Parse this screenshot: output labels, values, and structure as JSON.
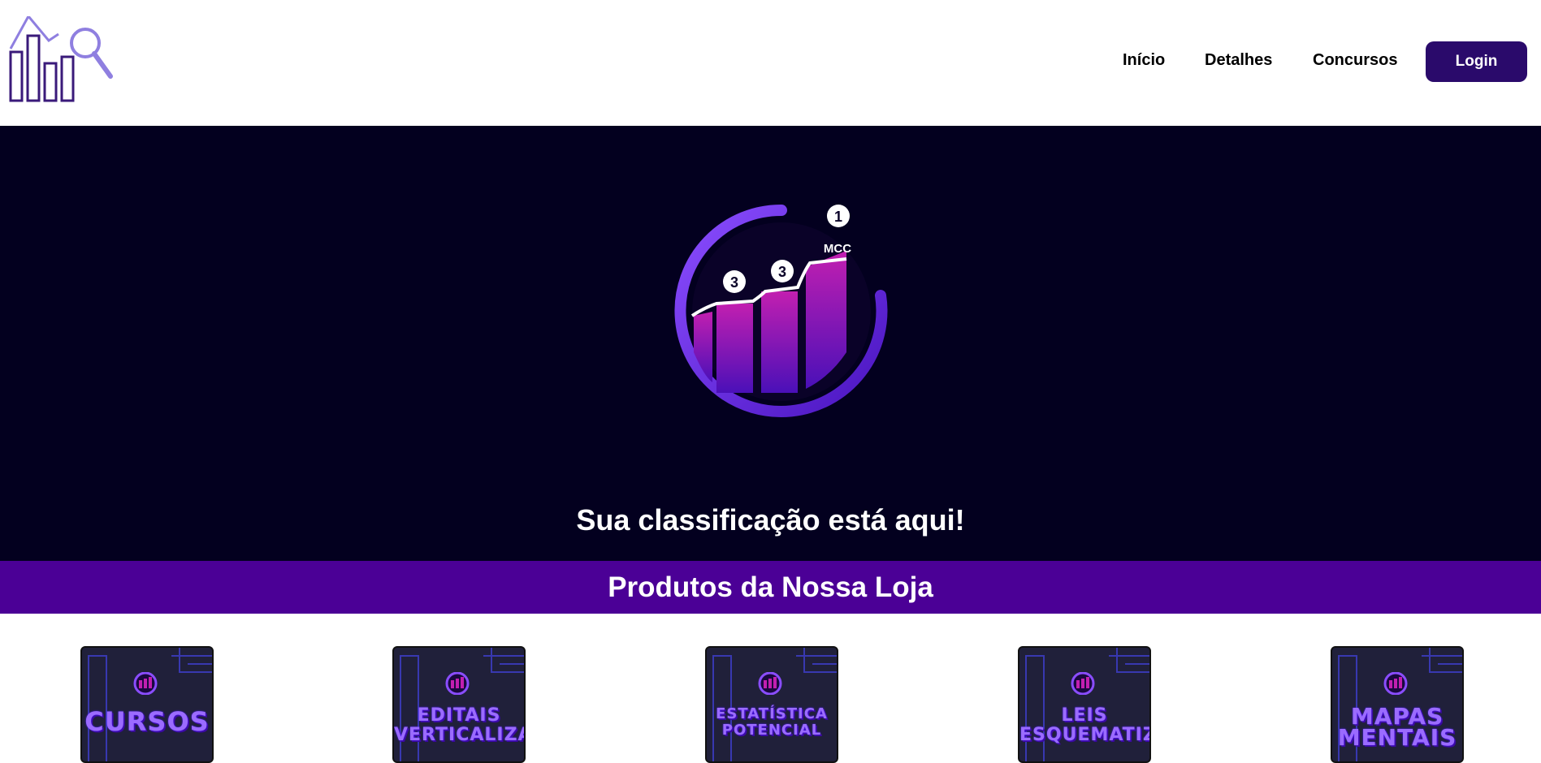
{
  "header": {
    "nav": {
      "home": "Início",
      "details": "Detalhes",
      "contests": "Concursos",
      "login": "Login"
    }
  },
  "hero": {
    "emblem_ranks": [
      "3",
      "3",
      "1"
    ],
    "emblem_text": "MCC",
    "title": "Sua classificação está aqui!"
  },
  "store": {
    "title": "Produtos da Nossa Loja",
    "products": [
      {
        "label": "CURSOS"
      },
      {
        "label": "EDITAIS VERTICALIZADOS"
      },
      {
        "label": "ESTATÍSTICA POTENCIAL"
      },
      {
        "label": "LEIS ESQUEMATIZADAS"
      },
      {
        "label": "MAPAS MENTAIS"
      }
    ]
  },
  "colors": {
    "hero_bg": "#03001f",
    "band_bg": "#4b0096",
    "login_bg": "#2a0a6b",
    "logo_stroke": "#3a1a7a",
    "logo_accent": "#8f7fe0"
  }
}
